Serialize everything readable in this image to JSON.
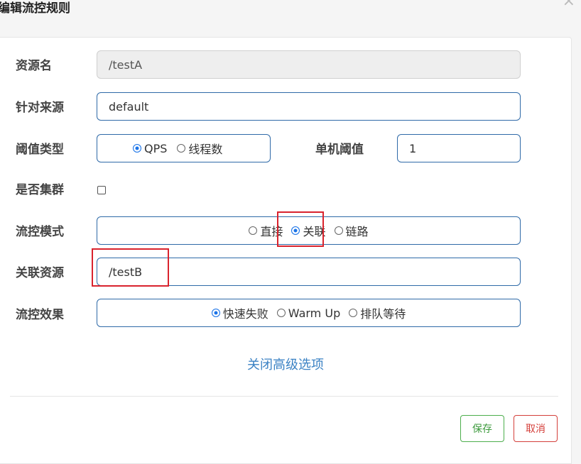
{
  "dialog": {
    "title": "编辑流控规则"
  },
  "form": {
    "resource_name": {
      "label": "资源名",
      "value": "/testA"
    },
    "limit_app": {
      "label": "针对来源",
      "value": "default"
    },
    "threshold_type": {
      "label": "阈值类型",
      "options": [
        "QPS",
        "线程数"
      ],
      "selected": "QPS"
    },
    "threshold": {
      "label": "单机阈值",
      "value": "1"
    },
    "cluster": {
      "label": "是否集群",
      "checked": false
    },
    "strategy": {
      "label": "流控模式",
      "options": [
        "直接",
        "关联",
        "链路"
      ],
      "selected": "关联"
    },
    "ref_resource": {
      "label": "关联资源",
      "value": "/testB"
    },
    "control_behavior": {
      "label": "流控效果",
      "options": [
        "快速失败",
        "Warm Up",
        "排队等待"
      ],
      "selected": "快速失败"
    }
  },
  "advanced_link": "关闭高级选项",
  "buttons": {
    "save": "保存",
    "cancel": "取消"
  },
  "colors": {
    "highlight": "#d9232d",
    "accent": "#1a73e8",
    "save": "#4cae4c",
    "cancel": "#d43f3a"
  }
}
